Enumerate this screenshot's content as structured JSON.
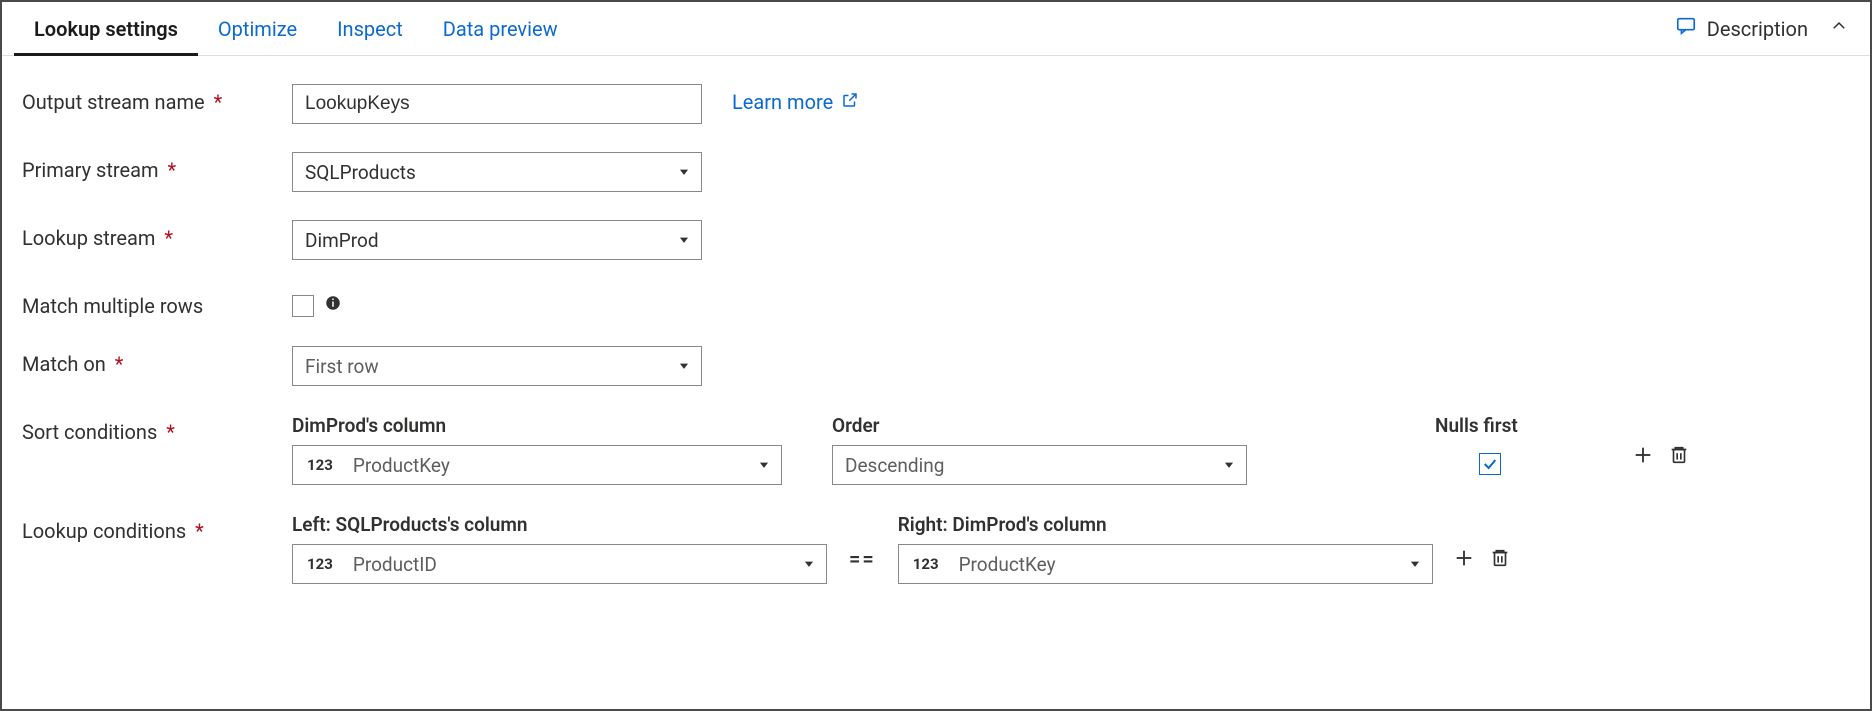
{
  "tabs": {
    "lookup_settings": "Lookup settings",
    "optimize": "Optimize",
    "inspect": "Inspect",
    "data_preview": "Data preview"
  },
  "header": {
    "description_btn": "Description"
  },
  "form": {
    "output_stream_name": {
      "label": "Output stream name",
      "value": "LookupKeys",
      "required": true
    },
    "primary_stream": {
      "label": "Primary stream",
      "value": "SQLProducts",
      "required": true
    },
    "lookup_stream": {
      "label": "Lookup stream",
      "value": "DimProd",
      "required": true
    },
    "match_multiple_rows": {
      "label": "Match multiple rows",
      "checked": false
    },
    "match_on": {
      "label": "Match on",
      "value": "First row",
      "required": true
    },
    "learn_more": "Learn more"
  },
  "sort_conditions": {
    "label": "Sort conditions",
    "required": true,
    "column_header": "DimProd's column",
    "order_header": "Order",
    "nulls_header": "Nulls first",
    "rows": [
      {
        "column_type": "123",
        "column_name": "ProductKey",
        "order": "Descending",
        "nulls_first": true
      }
    ]
  },
  "lookup_conditions": {
    "label": "Lookup conditions",
    "required": true,
    "left_header": "Left: SQLProducts's column",
    "right_header": "Right: DimProd's column",
    "operator": "==",
    "rows": [
      {
        "left_type": "123",
        "left_name": "ProductID",
        "right_type": "123",
        "right_name": "ProductKey"
      }
    ]
  }
}
